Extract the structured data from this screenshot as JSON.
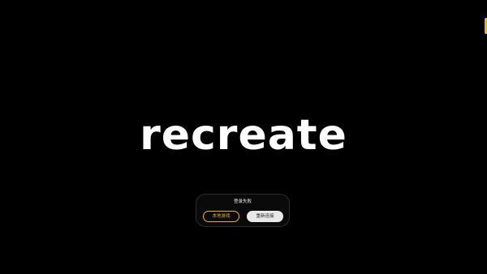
{
  "logo": {
    "text": "recreate"
  },
  "dialog": {
    "title": "登录失败",
    "local_game_label": "本地游戏",
    "reconnect_label": "重新连接"
  },
  "colors": {
    "background": "#000000",
    "accent": "#e6b31e",
    "logo": "#ffffff",
    "dialog_bg": "#0a0a0a",
    "secondary_button_bg": "#e8e8e8"
  }
}
